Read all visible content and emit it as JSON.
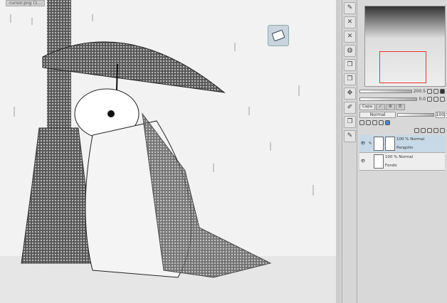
{
  "document": {
    "tab_label": "cursor.png (1..."
  },
  "toolbar": {
    "eraser_tooltip_icon": "eraser-icon"
  },
  "tools": [
    "pen",
    "eraser-x",
    "eraser-x",
    "fill",
    "layer",
    "layer",
    "move",
    "ruler",
    "layer",
    "pen"
  ],
  "navigator": {
    "zoom": "200.5",
    "rotation": "0.0"
  },
  "layer_panel": {
    "tab_label": "Capa",
    "blend_mode": "Normal",
    "opacity": "100",
    "layers": [
      {
        "opacity_mode": "100 % Normal",
        "name": "Pangolin",
        "selected": true
      },
      {
        "opacity_mode": "100 % Normal",
        "name": "Fondo",
        "selected": false
      }
    ]
  },
  "colors": {
    "accent": "#c7d9e6",
    "nav_frame": "#e33333"
  }
}
